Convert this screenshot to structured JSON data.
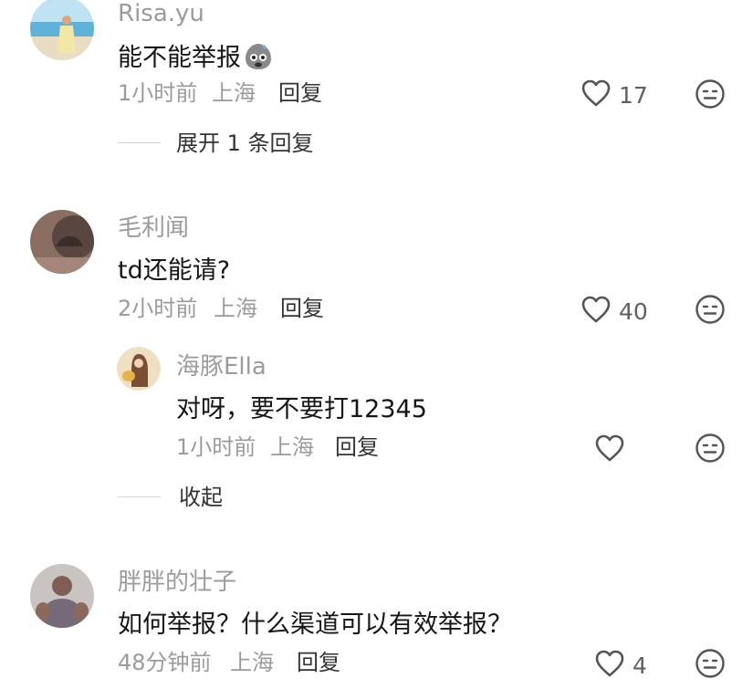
{
  "colors": {
    "username": "#9b9b9b",
    "content": "#161616",
    "meta": "#9b9b9b",
    "action": "#333333",
    "icon": "#555555",
    "divider": "#d6d6d6"
  },
  "comments": [
    {
      "username": "Risa.yu",
      "content": "能不能举报",
      "content_emoji": "sweat-face-emoji",
      "time": "1小时前",
      "location": "上海",
      "reply_label": "回复",
      "like_count": "17",
      "expand_label": "展开 1 条回复"
    },
    {
      "username": "毛利闻",
      "content": "td还能请?",
      "time": "2小时前",
      "location": "上海",
      "reply_label": "回复",
      "like_count": "40",
      "replies": [
        {
          "username": "海豚Ella",
          "content": "对呀，要不要打12345",
          "time": "1小时前",
          "location": "上海",
          "reply_label": "回复",
          "like_count": ""
        }
      ],
      "collapse_label": "收起"
    },
    {
      "username": "胖胖的壮子",
      "content": "如何举报？什么渠道可以有效举报？",
      "time": "48分钟前",
      "location": "上海",
      "reply_label": "回复",
      "like_count": "4"
    }
  ]
}
